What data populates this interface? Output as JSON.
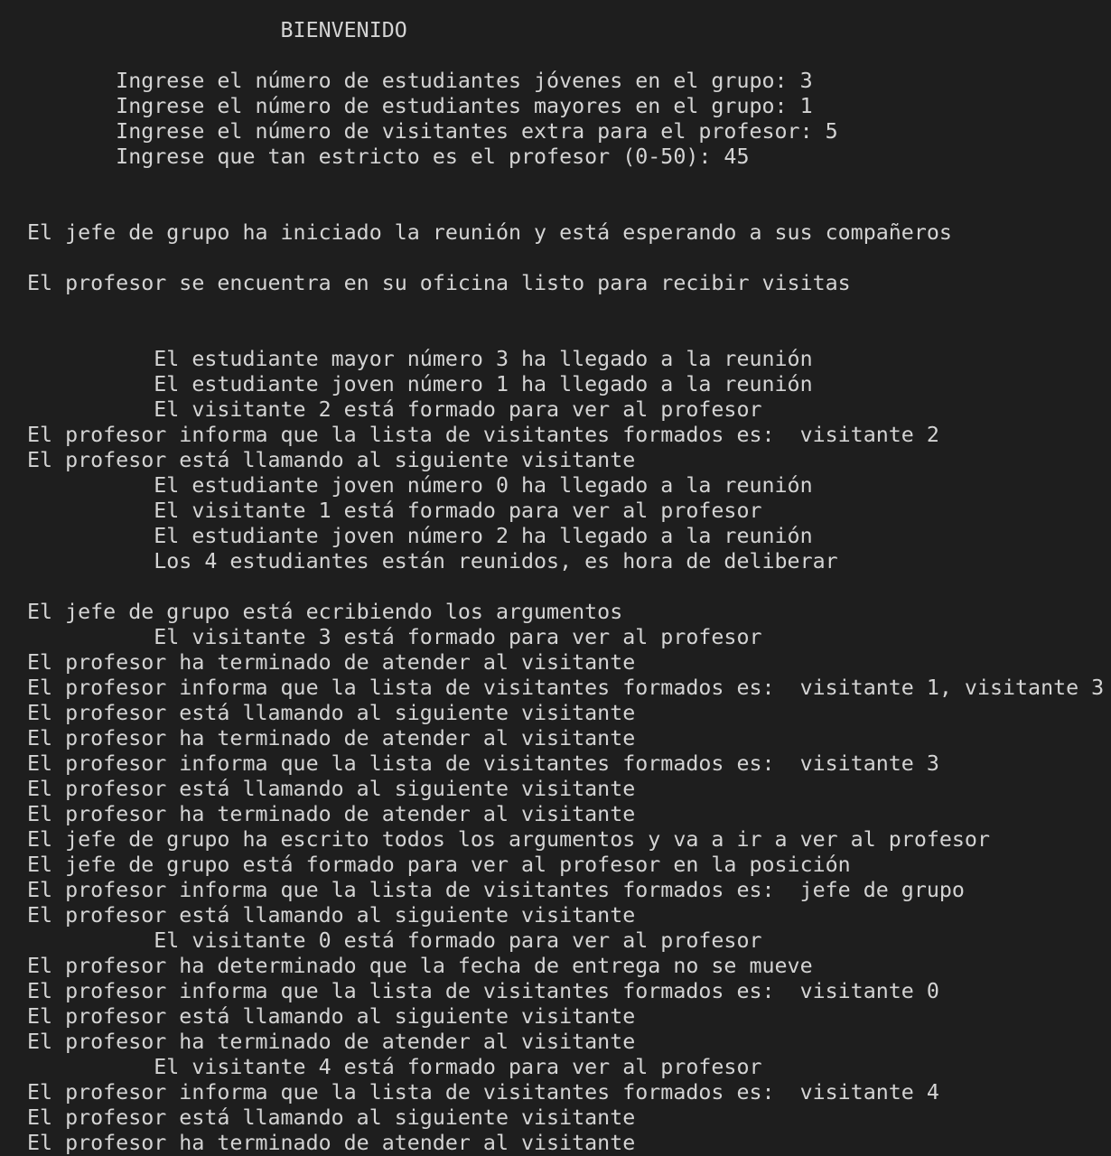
{
  "terminal": {
    "lines": [
      "                    BIENVENIDO",
      "",
      "       Ingrese el número de estudiantes jóvenes en el grupo: 3",
      "       Ingrese el número de estudiantes mayores en el grupo: 1",
      "       Ingrese el número de visitantes extra para el profesor: 5",
      "       Ingrese que tan estricto es el profesor (0-50): 45",
      "",
      "",
      "El jefe de grupo ha iniciado la reunión y está esperando a sus compañeros",
      "",
      "El profesor se encuentra en su oficina listo para recibir visitas",
      "",
      "",
      "          El estudiante mayor número 3 ha llegado a la reunión",
      "          El estudiante joven número 1 ha llegado a la reunión",
      "          El visitante 2 está formado para ver al profesor",
      "El profesor informa que la lista de visitantes formados es:  visitante 2",
      "El profesor está llamando al siguiente visitante",
      "          El estudiante joven número 0 ha llegado a la reunión",
      "          El visitante 1 está formado para ver al profesor",
      "          El estudiante joven número 2 ha llegado a la reunión",
      "          Los 4 estudiantes están reunidos, es hora de deliberar",
      "",
      "El jefe de grupo está ecribiendo los argumentos",
      "          El visitante 3 está formado para ver al profesor",
      "El profesor ha terminado de atender al visitante",
      "El profesor informa que la lista de visitantes formados es:  visitante 1, visitante 3",
      "El profesor está llamando al siguiente visitante",
      "El profesor ha terminado de atender al visitante",
      "El profesor informa que la lista de visitantes formados es:  visitante 3",
      "El profesor está llamando al siguiente visitante",
      "El profesor ha terminado de atender al visitante",
      "El jefe de grupo ha escrito todos los argumentos y va a ir a ver al profesor",
      "El jefe de grupo está formado para ver al profesor en la posición",
      "El profesor informa que la lista de visitantes formados es:  jefe de grupo",
      "El profesor está llamando al siguiente visitante",
      "          El visitante 0 está formado para ver al profesor",
      "El profesor ha determinado que la fecha de entrega no se mueve",
      "El profesor informa que la lista de visitantes formados es:  visitante 0",
      "El profesor está llamando al siguiente visitante",
      "El profesor ha terminado de atender al visitante",
      "          El visitante 4 está formado para ver al profesor",
      "El profesor informa que la lista de visitantes formados es:  visitante 4",
      "El profesor está llamando al siguiente visitante",
      "El profesor ha terminado de atender al visitante"
    ]
  }
}
